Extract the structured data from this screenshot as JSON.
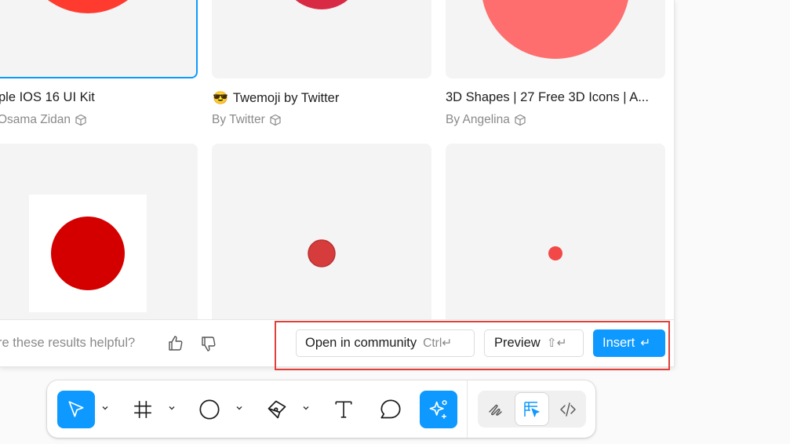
{
  "cards": [
    {
      "title": "ple IOS 16 UI Kit",
      "author": "Osama Zidan",
      "selected": true
    },
    {
      "title": "Twemoji by Twitter",
      "title_emoji": "😎",
      "author": "By Twitter",
      "selected": false
    },
    {
      "title": "3D Shapes | 27 Free 3D Icons | A...",
      "author": "By Angelina",
      "selected": false
    }
  ],
  "colors": {
    "accent": "#0d99ff",
    "highlight_border": "#e0403a",
    "circle_card1": "#ff3b30",
    "circle_card2": "#d92a45",
    "circle_card3": "#ff6e6e",
    "circle_red_large": "#d40000",
    "circle_red_medium": "#d63c3c",
    "circle_red_small": "#f24848"
  },
  "footer": {
    "helpful_text": "re these results helpful?",
    "open_community_label": "Open in community",
    "open_community_shortcut": "Ctrl↵",
    "preview_label": "Preview",
    "preview_shortcut": "⇧↵",
    "insert_label": "Insert",
    "insert_shortcut": "↵"
  },
  "toolbar": {
    "tools": [
      "move-icon",
      "frame-icon",
      "ellipse-icon",
      "pen-icon",
      "text-icon",
      "comment-icon",
      "ai-sparkle-icon"
    ],
    "active_tool": "move-icon",
    "modes": [
      "draw-mode-icon",
      "design-mode-icon",
      "dev-mode-icon"
    ],
    "active_mode": "design-mode-icon"
  }
}
